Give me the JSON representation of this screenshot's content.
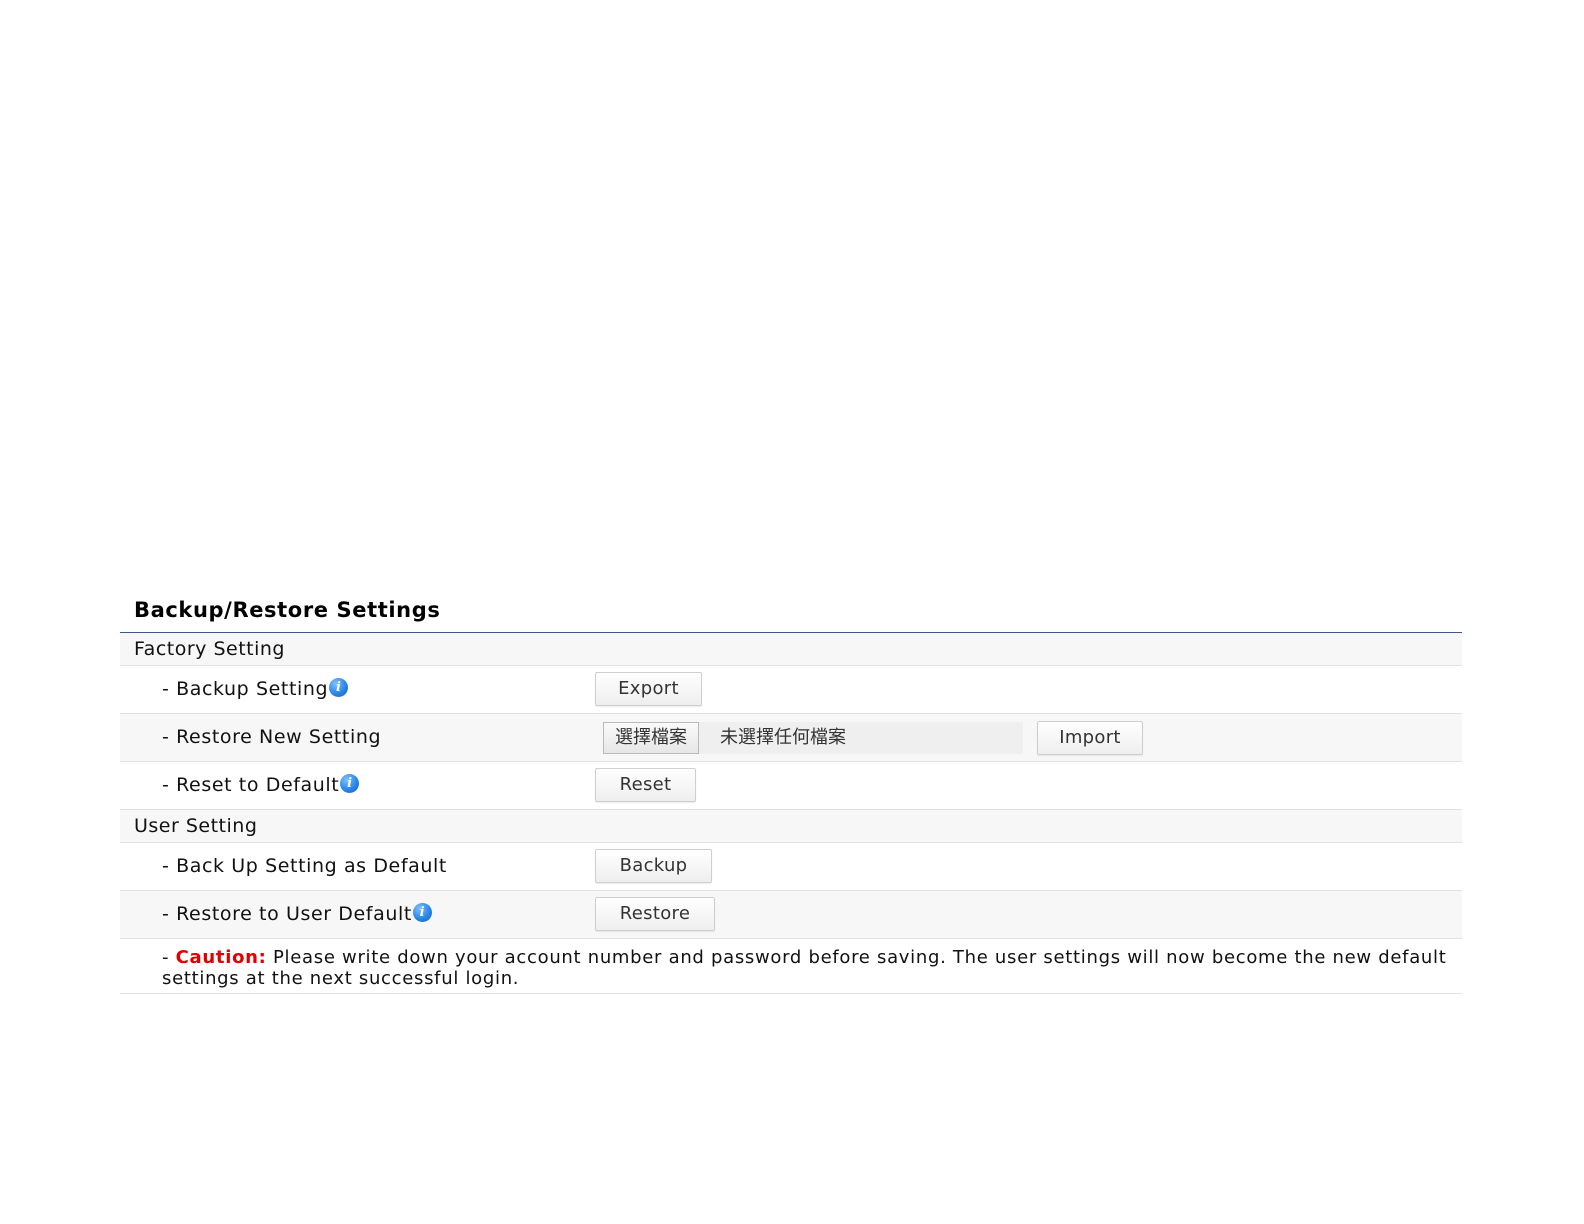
{
  "title": "Backup/Restore Settings",
  "factory_setting": {
    "header": "Factory Setting",
    "backup": {
      "label": "- Backup Setting",
      "button": "Export"
    },
    "restore_new": {
      "label": "- Restore New Setting",
      "file_button": "選擇檔案",
      "file_status": "未選擇任何檔案",
      "button": "Import"
    },
    "reset": {
      "label": "- Reset to Default",
      "button": "Reset"
    }
  },
  "user_setting": {
    "header": "User Setting",
    "backup_default": {
      "label": "- Back Up Setting as Default",
      "button": "Backup"
    },
    "restore_user": {
      "label": "- Restore to User Default",
      "button": "Restore"
    }
  },
  "caution": {
    "prefix": "- ",
    "word": "Caution:",
    "text": " Please write down your account number and password before saving. The user settings will now become the new default settings at the next successful login."
  },
  "icons": {
    "info": "info-icon",
    "info_glyph": "i"
  },
  "colors": {
    "caution": "#e00000",
    "title_rule": "#3a5a8c",
    "info_icon": "#2a86e6"
  }
}
